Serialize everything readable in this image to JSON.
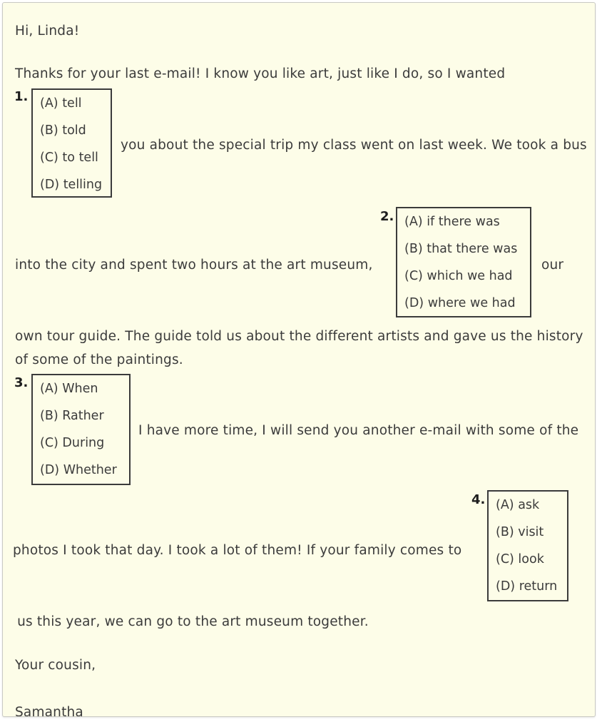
{
  "document": {
    "type": "cloze-reading-exercise",
    "background_color": "#fdfde8",
    "text_color": "#3b3b3b",
    "box_border_color": "#3b3b3b",
    "card_border_color": "#c9c9c4"
  },
  "passage": {
    "greeting": "Hi, Linda!",
    "line_1": "Thanks for your last e-mail! I know you like art, just like I do, so I wanted",
    "line_2": "you about the special trip my class went on last week. We took a bus",
    "line_3": "into the city and spent two hours at the art museum,",
    "line_3_tail": "our",
    "line_4": "own tour guide. The guide told us about the different artists and gave us the history",
    "line_5": "of some of the paintings.",
    "line_6": "I have more time, I will send you another e-mail with some of the",
    "line_7": "photos I took that day. I took a lot of them! If your family comes to",
    "line_8": " us this year, we can go to the art museum together.",
    "closing": "Your cousin,",
    "signature": "Samantha"
  },
  "questions": [
    {
      "number": "1.",
      "options": [
        "(A) tell",
        "(B) told",
        "(C) to tell",
        "(D) telling"
      ]
    },
    {
      "number": "2.",
      "options": [
        "(A) if there was",
        "(B) that there was",
        "(C) which we had",
        "(D) where we had"
      ]
    },
    {
      "number": "3.",
      "options": [
        "(A) When",
        "(B) Rather",
        "(C) During",
        "(D) Whether"
      ]
    },
    {
      "number": "4.",
      "options": [
        "(A) ask",
        "(B) visit",
        "(C) look",
        "(D) return"
      ]
    }
  ]
}
